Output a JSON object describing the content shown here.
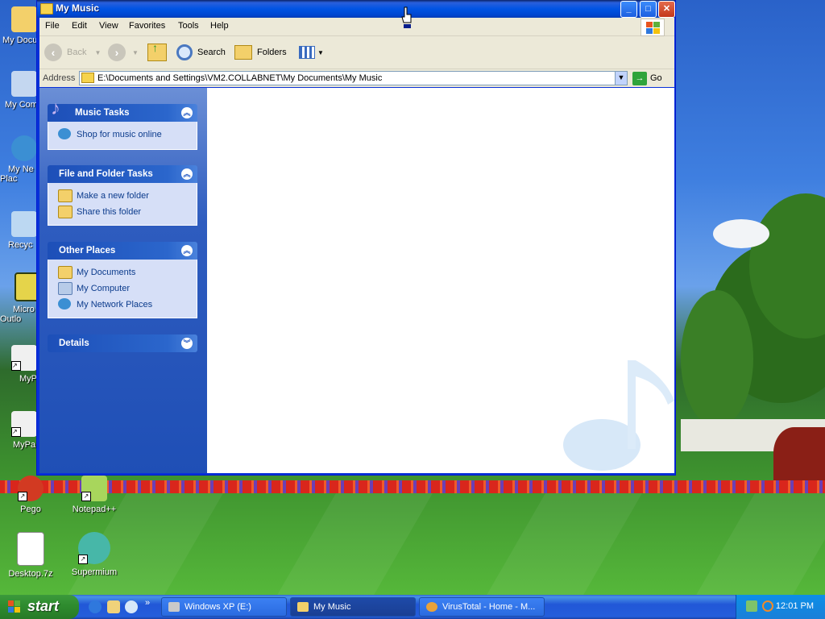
{
  "window": {
    "title": "My Music",
    "menu": [
      "File",
      "Edit",
      "View",
      "Favorites",
      "Tools",
      "Help"
    ],
    "toolbar": {
      "back": "Back",
      "search": "Search",
      "folders": "Folders"
    },
    "address": {
      "label": "Address",
      "path": "E:\\Documents and Settings\\VM2.COLLABNET\\My Documents\\My Music",
      "go": "Go"
    }
  },
  "taskpane": {
    "music_tasks": {
      "title": "Music Tasks",
      "items": [
        {
          "label": "Shop for music online",
          "icon": "globe-icon"
        }
      ]
    },
    "file_folder_tasks": {
      "title": "File and Folder Tasks",
      "items": [
        {
          "label": "Make a new folder",
          "icon": "new-folder-icon"
        },
        {
          "label": "Share this folder",
          "icon": "share-folder-icon"
        }
      ]
    },
    "other_places": {
      "title": "Other Places",
      "items": [
        {
          "label": "My Documents",
          "icon": "my-documents-icon"
        },
        {
          "label": "My Computer",
          "icon": "my-computer-icon"
        },
        {
          "label": "My Network Places",
          "icon": "network-places-icon"
        }
      ]
    },
    "details": {
      "title": "Details"
    }
  },
  "desktop": {
    "icons": [
      {
        "label": "My Docu"
      },
      {
        "label": "My Com"
      },
      {
        "label": "My Ne\nPlac"
      },
      {
        "label": "Recyc"
      },
      {
        "label": "Micro\nOutlo"
      },
      {
        "label": "MyP"
      },
      {
        "label": "MyPa"
      },
      {
        "label": "Pego"
      },
      {
        "label": "Notepad++"
      },
      {
        "label": "Desktop.7z"
      },
      {
        "label": "Supermium"
      }
    ]
  },
  "taskbar": {
    "start": "start",
    "buttons": [
      {
        "label": "Windows XP (E:)"
      },
      {
        "label": "My Music"
      },
      {
        "label": "VirusTotal - Home - M..."
      }
    ],
    "clock": "12:01 PM"
  },
  "colors": {
    "xp_blue": "#0054e3",
    "start_green": "#2e8b2e",
    "taskpane_blue": "#2e5cbf",
    "link_blue": "#0b3b8c"
  }
}
